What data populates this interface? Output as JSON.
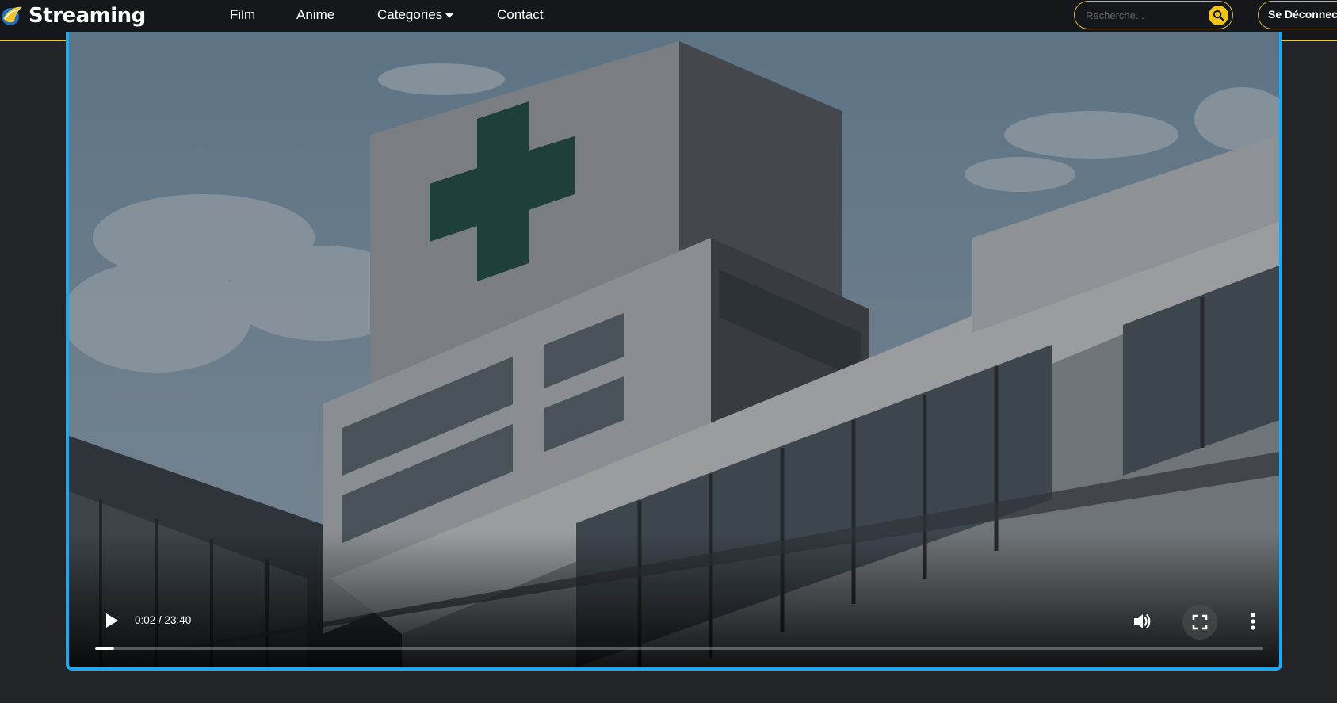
{
  "header": {
    "brand_name": "Streaming",
    "nav": {
      "film": "Film",
      "anime": "Anime",
      "categories": "Categories",
      "contact": "Contact"
    },
    "search": {
      "placeholder": "Recherche..."
    },
    "logout_label": "Se Déconnecter"
  },
  "player": {
    "time_display": "0:02 / 23:40",
    "progress_fraction": 0.016
  },
  "colors": {
    "accent_gold": "#e8c547",
    "search_button": "#f2c318",
    "player_border": "#1fa7f0",
    "background": "#232427",
    "navbar": "#15171a"
  },
  "icons": [
    "play-icon",
    "volume-icon",
    "fullscreen-icon",
    "more-vert-icon",
    "search-icon",
    "brand-logo-icon",
    "caret-down-icon"
  ]
}
